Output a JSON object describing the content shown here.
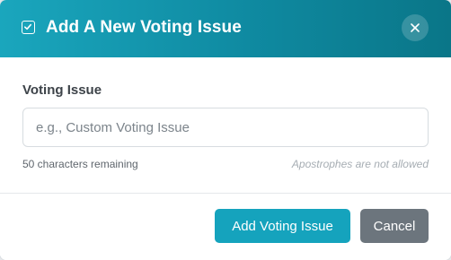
{
  "modal": {
    "title": "Add A New Voting Issue",
    "header_icon": "checkbox-icon",
    "close_icon": "close-icon",
    "header_colors": [
      "#1aa6bd",
      "#0a7688"
    ]
  },
  "form": {
    "label": "Voting Issue",
    "input_value": "",
    "input_placeholder": "e.g., Custom Voting Issue",
    "chars_remaining": "50 characters remaining",
    "hint": "Apostrophes are not allowed"
  },
  "footer": {
    "primary_label": "Add Voting Issue",
    "secondary_label": "Cancel",
    "primary_color": "#15a3bd",
    "secondary_color": "#6c757d"
  }
}
